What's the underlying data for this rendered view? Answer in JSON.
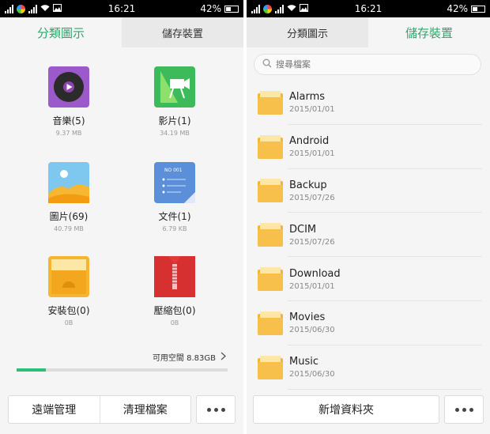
{
  "status": {
    "time": "16:21",
    "battery": "42%"
  },
  "left": {
    "tabs": [
      {
        "label": "分類圖示"
      },
      {
        "label": "儲存裝置"
      }
    ],
    "categories": [
      {
        "name": "音樂(5)",
        "size": "9.37 MB",
        "icon": "music-icon"
      },
      {
        "name": "影片(1)",
        "size": "34.19 MB",
        "icon": "video-icon"
      },
      {
        "name": "圖片(69)",
        "size": "40.79 MB",
        "icon": "picture-icon"
      },
      {
        "name": "文件(1)",
        "size": "6.79 KB",
        "icon": "document-icon"
      },
      {
        "name": "安裝包(0)",
        "size": "0B",
        "icon": "apk-icon"
      },
      {
        "name": "壓縮包(0)",
        "size": "0B",
        "icon": "zip-icon"
      }
    ],
    "doc_icon_text": "NO 001",
    "free_space": "可用空間 8.83GB",
    "usage_fraction": 0.14,
    "buttons": {
      "remote": "遠端管理",
      "clean": "清理檔案"
    }
  },
  "right": {
    "tabs": [
      {
        "label": "分類圖示"
      },
      {
        "label": "儲存裝置"
      }
    ],
    "search_placeholder": "搜尋檔案",
    "folders": [
      {
        "name": "Alarms",
        "date": "2015/01/01"
      },
      {
        "name": "Android",
        "date": "2015/01/01"
      },
      {
        "name": "Backup",
        "date": "2015/07/26"
      },
      {
        "name": "DCIM",
        "date": "2015/07/26"
      },
      {
        "name": "Download",
        "date": "2015/01/01"
      },
      {
        "name": "Movies",
        "date": "2015/06/30"
      },
      {
        "name": "Music",
        "date": "2015/06/30"
      }
    ],
    "buttons": {
      "new_folder": "新增資料夾"
    }
  },
  "colors": {
    "accent": "#2aa86b",
    "folder": "#f5b52e",
    "progress": "#2ac07a"
  }
}
